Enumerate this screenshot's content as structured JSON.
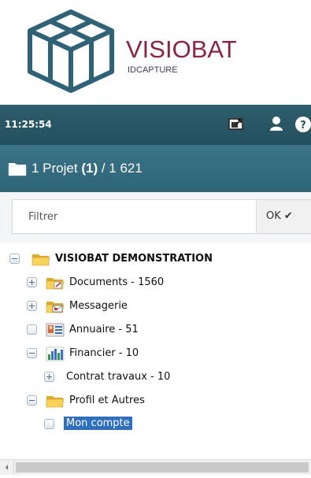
{
  "brand": {
    "name": "VISIOBAT",
    "subtitle": "IDCAPTURE",
    "color": "#8a2442"
  },
  "status": {
    "time": "11:25:54",
    "icons": [
      "export-icon",
      "user-icon",
      "help-icon"
    ]
  },
  "project": {
    "count_prefix": "1 Projet",
    "count_paren": "(1)",
    "count_suffix": "/ 1 621"
  },
  "filter": {
    "placeholder": "Filtrer",
    "ok_label": "OK"
  },
  "tree": [
    {
      "label": "VISIOBAT DEMONSTRATION",
      "toggle": "minus",
      "icon": "folder-icon",
      "bold": true
    },
    {
      "label": "Documents - 1560",
      "toggle": "plus",
      "icon": "documents-folder-icon"
    },
    {
      "label": "Messagerie",
      "toggle": "plus",
      "icon": "mail-folder-icon"
    },
    {
      "label": "Annuaire - 51",
      "toggle": "none",
      "icon": "contacts-icon"
    },
    {
      "label": "Financier - 10",
      "toggle": "minus",
      "icon": "chart-icon"
    },
    {
      "label": "Contrat travaux - 10",
      "toggle": "plus",
      "icon": ""
    },
    {
      "label": "Profil et Autres",
      "toggle": "minus",
      "icon": "folder-icon"
    },
    {
      "label": "Mon compte",
      "toggle": "none",
      "icon": "",
      "selected": true
    }
  ],
  "colors": {
    "statusbar": "#2e5d6c",
    "projectbar": "#3b7387",
    "selection": "#2f6fbe"
  }
}
